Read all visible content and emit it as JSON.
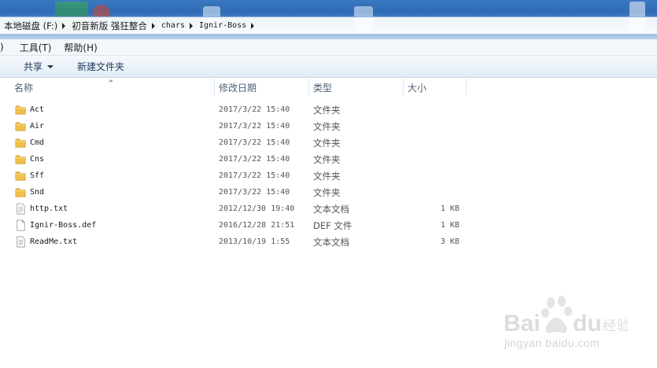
{
  "breadcrumb": {
    "drive": "本地磁盘 (F:)",
    "folder1": "初音新版 强狂整合",
    "folder2": "chars",
    "folder3": "Ignir-Boss"
  },
  "menubar": {
    "edge": ")",
    "tools": "工具(T)",
    "help": "帮助(H)"
  },
  "toolbar": {
    "share": "共享",
    "new_folder": "新建文件夹"
  },
  "columns": {
    "name": "名称",
    "date": "修改日期",
    "type": "类型",
    "size": "大小"
  },
  "files": [
    {
      "name": "Act",
      "date": "2017/3/22 15:40",
      "type": "文件夹",
      "size": "",
      "icon": "folder-icon"
    },
    {
      "name": "Air",
      "date": "2017/3/22 15:40",
      "type": "文件夹",
      "size": "",
      "icon": "folder-icon"
    },
    {
      "name": "Cmd",
      "date": "2017/3/22 15:40",
      "type": "文件夹",
      "size": "",
      "icon": "folder-icon"
    },
    {
      "name": "Cns",
      "date": "2017/3/22 15:40",
      "type": "文件夹",
      "size": "",
      "icon": "folder-icon"
    },
    {
      "name": "Sff",
      "date": "2017/3/22 15:40",
      "type": "文件夹",
      "size": "",
      "icon": "folder-icon"
    },
    {
      "name": "Snd",
      "date": "2017/3/22 15:40",
      "type": "文件夹",
      "size": "",
      "icon": "folder-icon"
    },
    {
      "name": "http.txt",
      "date": "2012/12/30 19:40",
      "type": "文本文档",
      "size": "1 KB",
      "icon": "text-file-icon"
    },
    {
      "name": "Ignir-Boss.def",
      "date": "2016/12/28 21:51",
      "type": "DEF 文件",
      "size": "1 KB",
      "icon": "file-icon"
    },
    {
      "name": "ReadMe.txt",
      "date": "2013/10/19 1:55",
      "type": "文本文档",
      "size": "3 KB",
      "icon": "text-file-icon"
    }
  ],
  "watermark": {
    "logo": "Baidu经验",
    "url": "jingyan.baidu.com"
  },
  "colors": {
    "folder": "#f0c14b",
    "header_text": "#4c607a",
    "toolbar_text": "#1e395b"
  }
}
